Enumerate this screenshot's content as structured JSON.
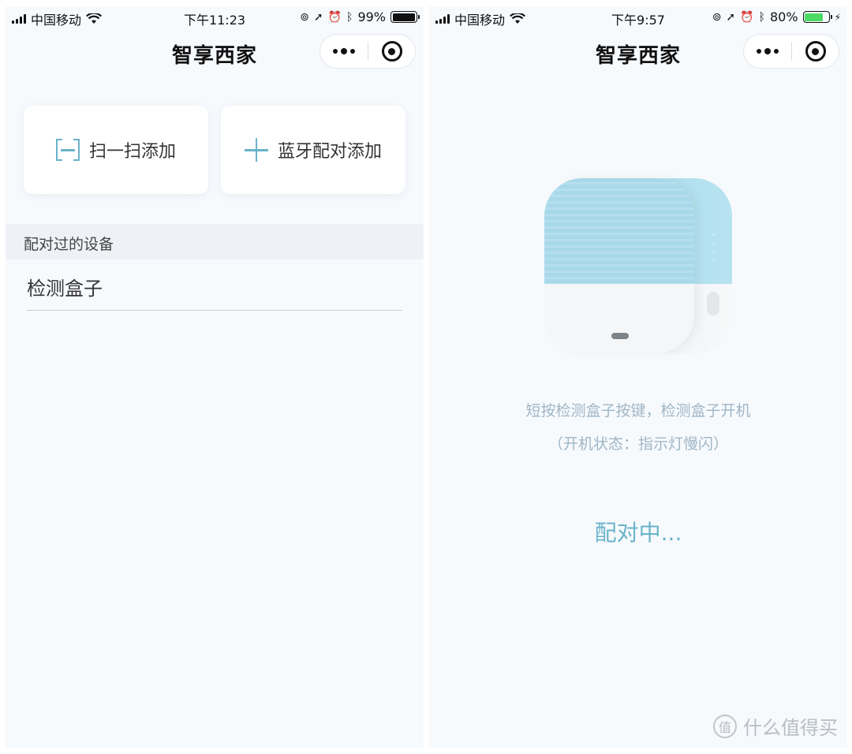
{
  "left_screen": {
    "statusbar": {
      "carrier": "中国移动",
      "time": "下午11:23",
      "battery_pct": "99%",
      "battery_level": 0.99
    },
    "titlebar": {
      "title": "智享西家"
    },
    "actions": {
      "scan_label": "扫一扫添加",
      "bluetooth_label": "蓝牙配对添加"
    },
    "section_header": "配对过的设备",
    "devices": [
      "检测盒子"
    ]
  },
  "right_screen": {
    "statusbar": {
      "carrier": "中国移动",
      "time": "下午9:57",
      "battery_pct": "80%",
      "battery_level": 0.8
    },
    "titlebar": {
      "title": "智享西家"
    },
    "hint_line1": "短按检测盒子按键，检测盒子开机",
    "hint_line2": "（开机状态：指示灯慢闪）",
    "status_text": "配对中..."
  },
  "watermark": {
    "logo_char": "值",
    "text": "什么值得买"
  },
  "colors": {
    "accent": "#6ab3ca",
    "hint": "#9fb6c6",
    "background": "#f7fafd",
    "battery_charging": "#4cd964"
  }
}
